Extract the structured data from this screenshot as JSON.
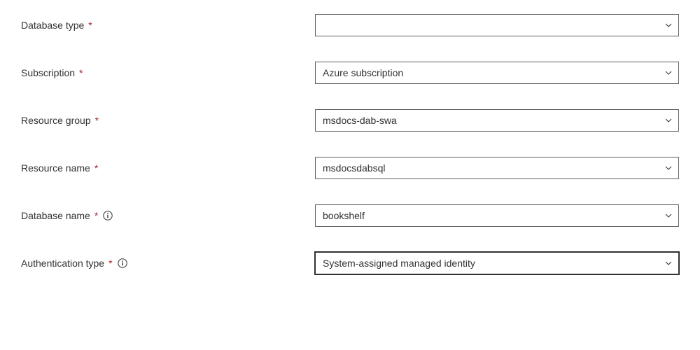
{
  "form": {
    "fields": [
      {
        "label": "Database type",
        "required_marker": "*",
        "has_info": false,
        "value": "",
        "focused": false
      },
      {
        "label": "Subscription",
        "required_marker": "*",
        "has_info": false,
        "value": "Azure subscription",
        "focused": false
      },
      {
        "label": "Resource group",
        "required_marker": "*",
        "has_info": false,
        "value": "msdocs-dab-swa",
        "focused": false
      },
      {
        "label": "Resource name",
        "required_marker": "*",
        "has_info": false,
        "value": "msdocsdabsql",
        "focused": false
      },
      {
        "label": "Database name",
        "required_marker": "*",
        "has_info": true,
        "value": "bookshelf",
        "focused": false
      },
      {
        "label": "Authentication type",
        "required_marker": "*",
        "has_info": true,
        "value": "System-assigned managed identity",
        "focused": true
      }
    ]
  }
}
